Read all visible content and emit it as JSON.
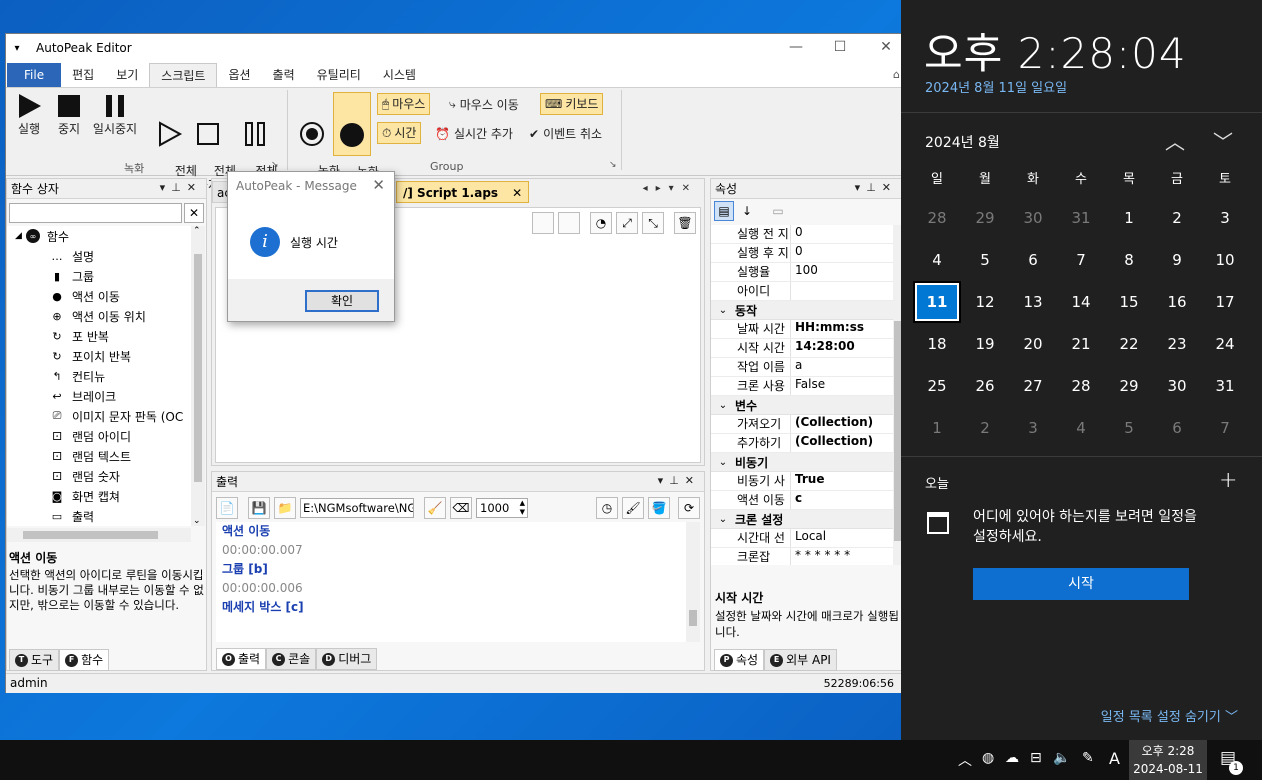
{
  "app": {
    "title": "AutoPeak Editor",
    "menu": [
      "File",
      "편집",
      "보기",
      "스크립트",
      "옵션",
      "출력",
      "유틸리티",
      "시스템"
    ],
    "ribbon": {
      "run": "실행",
      "stop": "중지",
      "pause": "일시중지",
      "run_all": "전체\n실행",
      "stop_all": "전체\n중지",
      "pause_all": "전체\n일시중지",
      "group1": "녹화",
      "rec_start": "녹화\n시작",
      "rec_stop": "녹화\n중지",
      "mouse": "마우스",
      "mouse_move": "마우스 이동",
      "keyboard": "키보드",
      "time": "시간",
      "realtime_add": "실시간 추가",
      "event_cancel": "이벤트 취소",
      "group2": "Group"
    },
    "func_pane": {
      "title": "함수 상자",
      "root": "함수",
      "items": [
        "설명",
        "그룹",
        "액션 이동",
        "액션 이동 위치",
        "포 반복",
        "포이치 반복",
        "컨티뉴",
        "브레이크",
        "이미지 문자 판독 (OC",
        "랜덤 아이디",
        "랜덤 텍스트",
        "랜덤 숫자",
        "화면 캡쳐",
        "출력"
      ],
      "desc_title": "액션 이동",
      "desc_text": "선택한 액션의 아이디로 루틴을 이동시킵니다. 비동기 그룹 내부로는 이동할 수 없지만, 밖으로는 이동할 수 있습니다.",
      "tabs": [
        "도구",
        "함수"
      ]
    },
    "doc": {
      "tab_left": "ac",
      "tab_active": "/] Script 1.aps"
    },
    "output": {
      "title": "출력",
      "path": "E:\\NGMsoftware\\NG",
      "limit": "1000",
      "lines": [
        "액션 이동",
        "00:00:00.007",
        "그룹 [b]",
        "00:00:00.006",
        "메세지 박스 [c]"
      ],
      "tabs": [
        "출력",
        "콘솔",
        "디버그"
      ]
    },
    "props": {
      "title": "속성",
      "rows": [
        {
          "k": "실행 전 지",
          "v": "0"
        },
        {
          "k": "실행 후 지",
          "v": "0"
        },
        {
          "k": "실행율",
          "v": "100"
        },
        {
          "k": "아이디",
          "v": ""
        }
      ],
      "cat_action": "동작",
      "action_rows": [
        {
          "k": "날짜 시간",
          "v": "HH:mm:ss"
        },
        {
          "k": "시작 시간",
          "v": "14:28:00"
        },
        {
          "k": "작업 이름",
          "v": "a"
        },
        {
          "k": "크론 사용",
          "v": "False"
        }
      ],
      "cat_var": "변수",
      "var_rows": [
        {
          "k": "가져오기",
          "v": "(Collection)"
        },
        {
          "k": "추가하기",
          "v": "(Collection)"
        }
      ],
      "cat_async": "비동기",
      "async_rows": [
        {
          "k": "비동기 사",
          "v": "True"
        },
        {
          "k": "액션 이동",
          "v": "c"
        }
      ],
      "cat_cron": "크론 설정",
      "cron_rows": [
        {
          "k": "시간대 선",
          "v": "Local"
        },
        {
          "k": "크론잡",
          "v": "* * * * * *"
        }
      ],
      "desc_title": "시작 시간",
      "desc_text": "설정한 날짜와 시간에 매크로가 실행됩니다.",
      "tabs": [
        "속성",
        "외부 API"
      ]
    },
    "status": {
      "user": "admin",
      "timer": "52289:06:56"
    }
  },
  "dialog": {
    "title": "AutoPeak - Message",
    "message": "실행 시간",
    "ok": "확인"
  },
  "flyout": {
    "time": "오후 2:28:04",
    "date": "2024년 8월 11일 일요일",
    "month": "2024년 8월",
    "weekdays": [
      "일",
      "월",
      "화",
      "수",
      "목",
      "금",
      "토"
    ],
    "days": [
      [
        "28",
        "29",
        "30",
        "31",
        "1",
        "2",
        "3"
      ],
      [
        "4",
        "5",
        "6",
        "7",
        "8",
        "9",
        "10"
      ],
      [
        "11",
        "12",
        "13",
        "14",
        "15",
        "16",
        "17"
      ],
      [
        "18",
        "19",
        "20",
        "21",
        "22",
        "23",
        "24"
      ],
      [
        "25",
        "26",
        "27",
        "28",
        "29",
        "30",
        "31"
      ],
      [
        "1",
        "2",
        "3",
        "4",
        "5",
        "6",
        "7"
      ]
    ],
    "today": "오늘",
    "agenda_text": "어디에 있어야 하는지를 보려면 일정을 설정하세요.",
    "start_button": "시작",
    "hide_link": "일정 목록 설정 숨기기",
    "accent": "#0078d4"
  },
  "taskbar": {
    "time": "오후 2:28",
    "date": "2024-08-11",
    "ime": "A",
    "notif_count": "1"
  }
}
